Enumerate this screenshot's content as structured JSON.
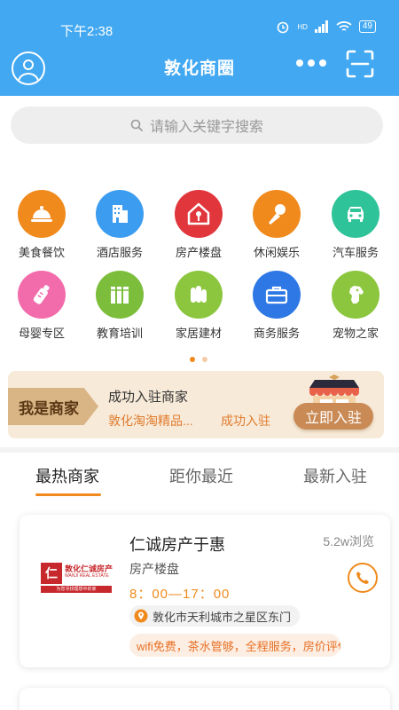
{
  "status_bar": {
    "time": "下午2:38",
    "hd": "HD",
    "battery": "49"
  },
  "header": {
    "title": "敦化商圈"
  },
  "search": {
    "placeholder": "请输入关键字搜索"
  },
  "categories": [
    {
      "label": "美食餐饮",
      "icon": "cloche-icon",
      "color": "#f08a1c"
    },
    {
      "label": "酒店服务",
      "icon": "hotel-icon",
      "color": "#3c9cf0"
    },
    {
      "label": "房产楼盘",
      "icon": "house-icon",
      "color": "#e0363c"
    },
    {
      "label": "休闲娱乐",
      "icon": "microphone-icon",
      "color": "#f08a1c"
    },
    {
      "label": "汽车服务",
      "icon": "car-icon",
      "color": "#2fc39a"
    },
    {
      "label": "母婴专区",
      "icon": "baby-bottle-icon",
      "color": "#f26cab"
    },
    {
      "label": "教育培训",
      "icon": "books-icon",
      "color": "#7cbe3c"
    },
    {
      "label": "家居建材",
      "icon": "building-material-icon",
      "color": "#8cc63f"
    },
    {
      "label": "商务服务",
      "icon": "briefcase-icon",
      "color": "#2e78e6"
    },
    {
      "label": "宠物之家",
      "icon": "dog-icon",
      "color": "#8cc63f"
    }
  ],
  "pager": {
    "active_color": "#f08a1c",
    "inactive_color": "#f4cba6"
  },
  "banner": {
    "tag": "我是商家",
    "title": "成功入驻商家",
    "sub_left": "敦化淘淘精品...",
    "sub_right": "成功入驻",
    "button": "立即入驻"
  },
  "tabs": [
    {
      "label": "最热商家",
      "active": true
    },
    {
      "label": "距你最近",
      "active": false
    },
    {
      "label": "最新入驻",
      "active": false
    }
  ],
  "merchants": [
    {
      "name": "仁诚房产于惠",
      "views": "5.2w浏览",
      "category": "房产楼盘",
      "hours": "8：00—17：00",
      "address": "敦化市天利城市之星区东门",
      "tags": "wifi免费，茶水管够，全程服务，房价评估",
      "logo": {
        "mark": "仁",
        "name": "敦化仁诚房产",
        "en": "WANJI REAL ESTATE",
        "slogan": "为您寻找理想中的家"
      }
    }
  ],
  "colors": {
    "header_bg": "#42a8f1",
    "accent": "#f08a1c"
  }
}
